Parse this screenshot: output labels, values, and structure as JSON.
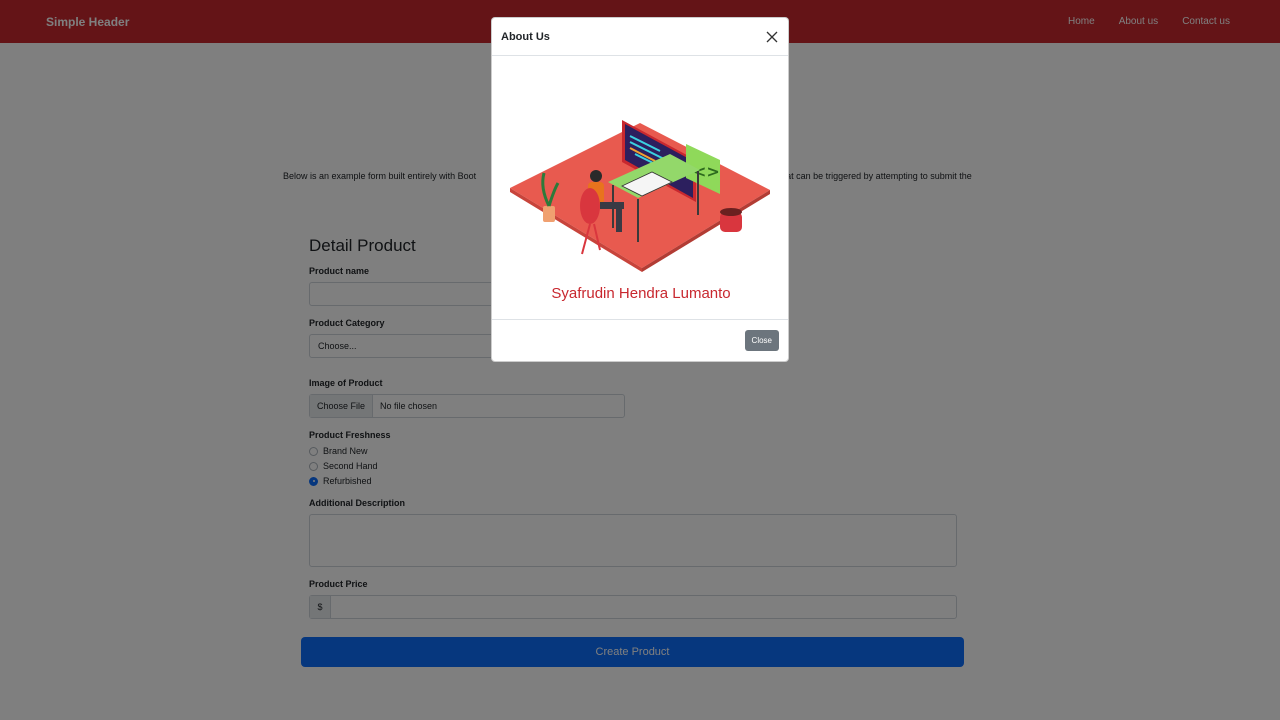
{
  "header": {
    "brand": "Simple Header",
    "nav": [
      "Home",
      "About us",
      "Contact us"
    ],
    "color": "#c8282f"
  },
  "intro": {
    "left_text": "Below is an example form built entirely with Boot",
    "right_text": "hat can be triggered by attempting to submit the"
  },
  "form": {
    "title": "Detail Product",
    "product_name_label": "Product name",
    "product_name_value": "",
    "category_label": "Product Category",
    "category_value": "Choose...",
    "image_label": "Image of Product",
    "file_button": "Choose File",
    "file_status": "No file chosen",
    "freshness_label": "Product Freshness",
    "freshness_options": [
      "Brand New",
      "Second Hand",
      "Refurbished"
    ],
    "freshness_selected": "Refurbished",
    "description_label": "Additional Description",
    "price_label": "Product Price",
    "price_prefix": "$",
    "submit_label": "Create Product"
  },
  "modal": {
    "title": "About Us",
    "name": "Syafrudin Hendra Lumanto",
    "close_label": "Close",
    "illustration_icon": "developer-at-desk-illustration"
  },
  "colors": {
    "primary": "#0d6efd",
    "brand_red": "#c8282f",
    "secondary": "#6c757d"
  }
}
